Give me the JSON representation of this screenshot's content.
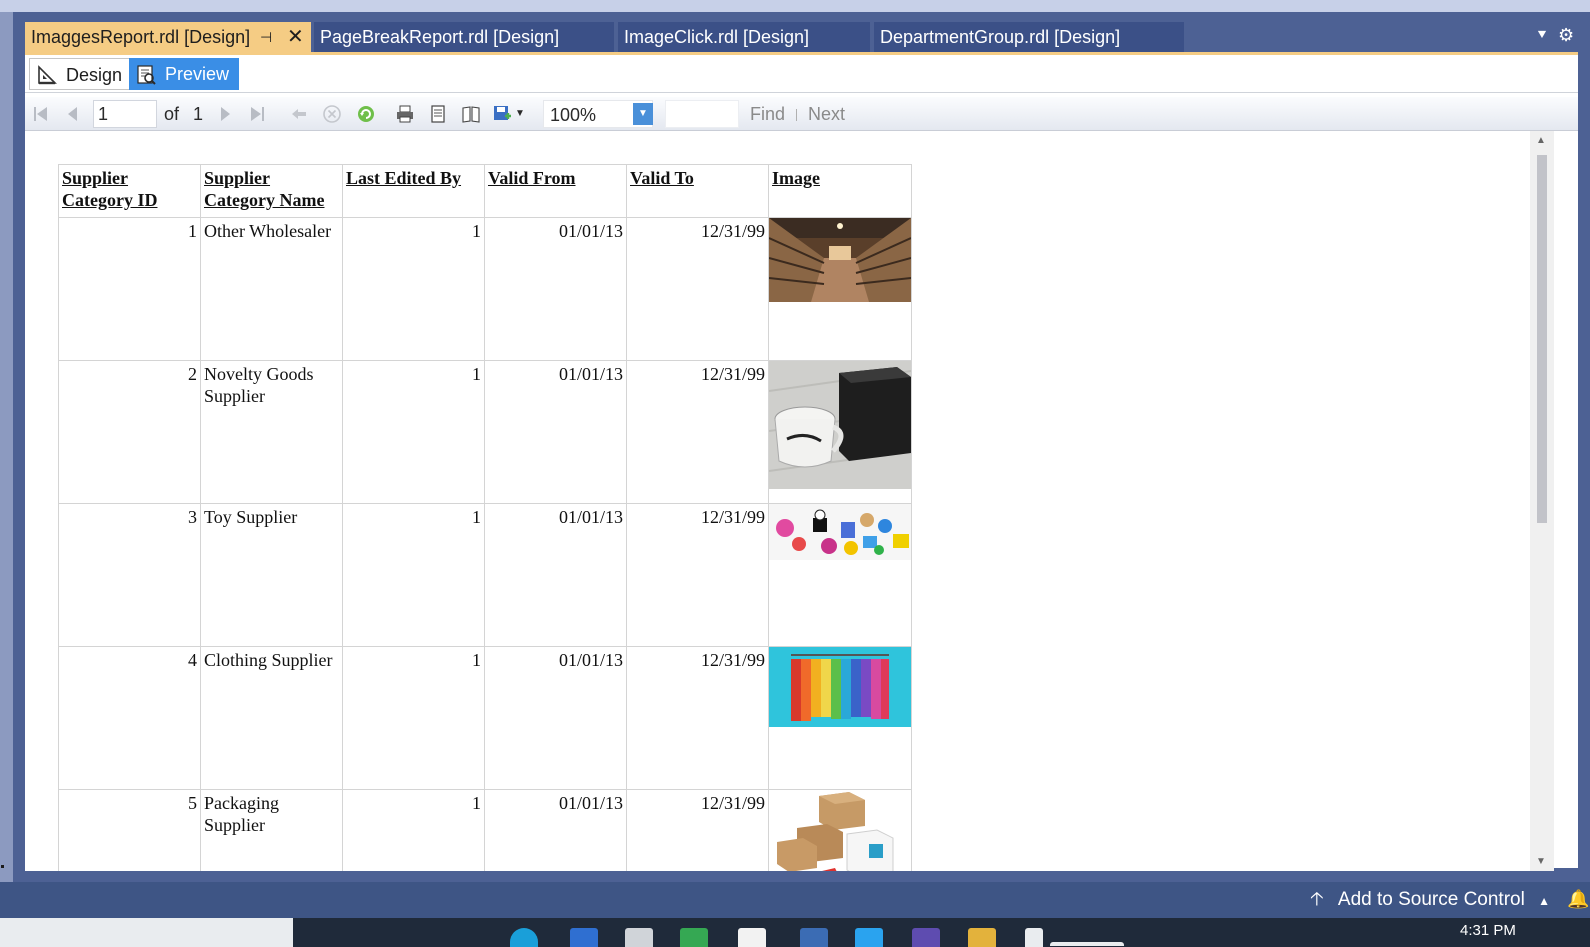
{
  "doc_tabs": [
    {
      "label": "ImaggesReport.rdl [Design]",
      "active": true
    },
    {
      "label": "PageBreakReport.rdl [Design]",
      "active": false
    },
    {
      "label": "ImageClick.rdl [Design]",
      "active": false
    },
    {
      "label": "DepartmentGroup.rdl [Design]",
      "active": false
    }
  ],
  "mode_tabs": {
    "design": "Design",
    "preview": "Preview"
  },
  "toolbar": {
    "page_current": "1",
    "of_label": "of",
    "page_total": "1",
    "zoom": "100%",
    "find_label": "Find",
    "next_label": "Next"
  },
  "table": {
    "headers": [
      "Supplier Category ID",
      "Supplier Category Name",
      "Last Edited By",
      "Valid From",
      "Valid To",
      "Image"
    ],
    "rows": [
      {
        "id": "1",
        "name": "Other Wholesaler",
        "edited_by": "1",
        "valid_from": "01/01/13",
        "valid_to": "12/31/99",
        "image": "warehouse-photo"
      },
      {
        "id": "2",
        "name": "Novelty Goods Supplier",
        "edited_by": "1",
        "valid_from": "01/01/13",
        "valid_to": "12/31/99",
        "image": "mug-and-box-photo"
      },
      {
        "id": "3",
        "name": "Toy Supplier",
        "edited_by": "1",
        "valid_from": "01/01/13",
        "valid_to": "12/31/99",
        "image": "toys-photo"
      },
      {
        "id": "4",
        "name": "Clothing Supplier",
        "edited_by": "1",
        "valid_from": "01/01/13",
        "valid_to": "12/31/99",
        "image": "clothing-rack-photo"
      },
      {
        "id": "5",
        "name": "Packaging Supplier",
        "edited_by": "1",
        "valid_from": "01/01/13",
        "valid_to": "12/31/99",
        "image": "packaging-boxes-photo"
      }
    ]
  },
  "status_bar": {
    "source_control": "Add to Source Control"
  },
  "clock": "4:31 PM",
  "colors": {
    "frame": "#4d6194",
    "active_tab": "#f5cc84",
    "preview_accent": "#3a8ee6",
    "status_bar": "#3e5585"
  }
}
